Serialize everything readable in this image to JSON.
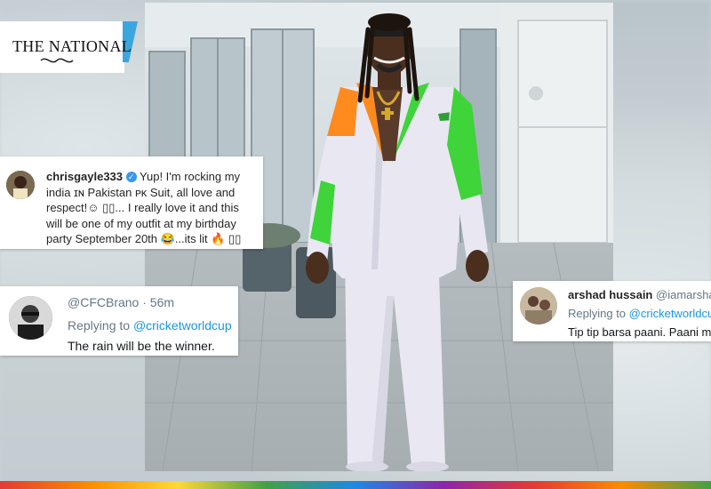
{
  "logo": {
    "text": "The National"
  },
  "instagram_comment": {
    "username": "chrisgayle333",
    "text": "Yup! I'm rocking my india ɪɴ Pakistan ᴘᴋ Suit, all love and respect!☺ ▯▯... I really love it and this will be one of my outfit at my birthday party September 20th 😂...its lit 🔥 ▯▯"
  },
  "tweet_left": {
    "handle": "@CFCBrano",
    "time": "· 56m",
    "replying_prefix": "Replying to",
    "replying_to": "@cricketworldcup",
    "text": "The rain will be the winner."
  },
  "tweet_right": {
    "name": "arshad hussain",
    "handle": "@iamarshad",
    "replying_prefix": "Replying to",
    "replying_to": "@cricketworldcup",
    "text": "Tip tip barsa paani. Paani me"
  },
  "colors": {
    "suit_orange": "#ff8a1e",
    "suit_green": "#3ed43a",
    "suit_white": "#e9e8f2",
    "verified_blue": "#3897f0",
    "link_blue": "#1b95e0",
    "logo_accent": "#3aa6e0"
  }
}
